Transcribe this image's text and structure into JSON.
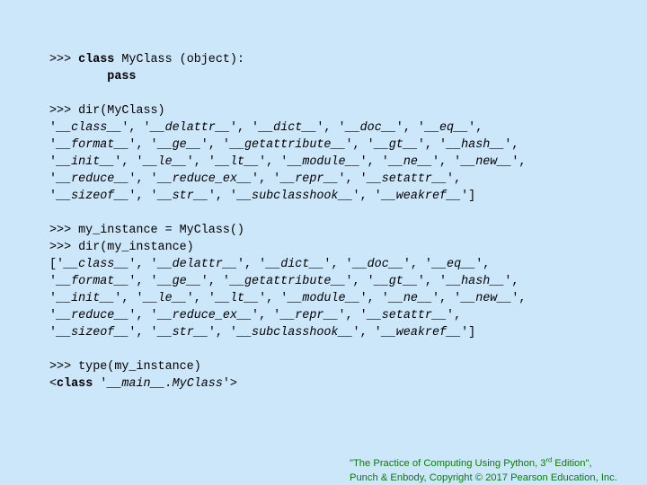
{
  "code_lines": [
    [
      {
        "t": ">>> "
      },
      {
        "t": "class",
        "kw": true
      },
      {
        "t": " MyClass (object):"
      }
    ],
    [
      {
        "t": "        "
      },
      {
        "t": "pass",
        "kw": true
      }
    ],
    [],
    [
      {
        "t": ">>> dir(MyClass)"
      }
    ],
    [
      {
        "t": "'"
      },
      {
        "t": "__class__",
        "it": true
      },
      {
        "t": "', '"
      },
      {
        "t": "__delattr__",
        "it": true
      },
      {
        "t": "', '"
      },
      {
        "t": "__dict__",
        "it": true
      },
      {
        "t": "', '"
      },
      {
        "t": "__doc__",
        "it": true
      },
      {
        "t": "', '"
      },
      {
        "t": "__eq__",
        "it": true
      },
      {
        "t": "',"
      }
    ],
    [
      {
        "t": "'"
      },
      {
        "t": "__format__",
        "it": true
      },
      {
        "t": "', '"
      },
      {
        "t": "__ge__",
        "it": true
      },
      {
        "t": "', '"
      },
      {
        "t": "__getattribute__",
        "it": true
      },
      {
        "t": "', '"
      },
      {
        "t": "__gt__",
        "it": true
      },
      {
        "t": "', '"
      },
      {
        "t": "__hash__",
        "it": true
      },
      {
        "t": "',"
      }
    ],
    [
      {
        "t": "'"
      },
      {
        "t": "__init__",
        "it": true
      },
      {
        "t": "', '"
      },
      {
        "t": "__le__",
        "it": true
      },
      {
        "t": "', '"
      },
      {
        "t": "__lt__",
        "it": true
      },
      {
        "t": "', '"
      },
      {
        "t": "__module__",
        "it": true
      },
      {
        "t": "', '"
      },
      {
        "t": "__ne__",
        "it": true
      },
      {
        "t": "', '"
      },
      {
        "t": "__new__",
        "it": true
      },
      {
        "t": "',"
      }
    ],
    [
      {
        "t": "'"
      },
      {
        "t": "__reduce__",
        "it": true
      },
      {
        "t": "', '"
      },
      {
        "t": "__reduce_ex__",
        "it": true
      },
      {
        "t": "', '"
      },
      {
        "t": "__repr__",
        "it": true
      },
      {
        "t": "', '"
      },
      {
        "t": "__setattr__",
        "it": true
      },
      {
        "t": "',"
      }
    ],
    [
      {
        "t": "'"
      },
      {
        "t": "__sizeof__",
        "it": true
      },
      {
        "t": "', '"
      },
      {
        "t": "__str__",
        "it": true
      },
      {
        "t": "', '"
      },
      {
        "t": "__subclasshook__",
        "it": true
      },
      {
        "t": "', '"
      },
      {
        "t": "__weakref__",
        "it": true
      },
      {
        "t": "']"
      }
    ],
    [],
    [
      {
        "t": ">>> my_instance = MyClass()"
      }
    ],
    [
      {
        "t": ">>> dir(my_instance)"
      }
    ],
    [
      {
        "t": "['"
      },
      {
        "t": "__class__",
        "it": true
      },
      {
        "t": "', '"
      },
      {
        "t": "__delattr__",
        "it": true
      },
      {
        "t": "', '"
      },
      {
        "t": "__dict__",
        "it": true
      },
      {
        "t": "', '"
      },
      {
        "t": "__doc__",
        "it": true
      },
      {
        "t": "', '"
      },
      {
        "t": "__eq__",
        "it": true
      },
      {
        "t": "',"
      }
    ],
    [
      {
        "t": "'"
      },
      {
        "t": "__format__",
        "it": true
      },
      {
        "t": "', '"
      },
      {
        "t": "__ge__",
        "it": true
      },
      {
        "t": "', '"
      },
      {
        "t": "__getattribute__",
        "it": true
      },
      {
        "t": "', '"
      },
      {
        "t": "__gt__",
        "it": true
      },
      {
        "t": "', '"
      },
      {
        "t": "__hash__",
        "it": true
      },
      {
        "t": "',"
      }
    ],
    [
      {
        "t": "'"
      },
      {
        "t": "__init__",
        "it": true
      },
      {
        "t": "', '"
      },
      {
        "t": "__le__",
        "it": true
      },
      {
        "t": "', '"
      },
      {
        "t": "__lt__",
        "it": true
      },
      {
        "t": "', '"
      },
      {
        "t": "__module__",
        "it": true
      },
      {
        "t": "', '"
      },
      {
        "t": "__ne__",
        "it": true
      },
      {
        "t": "', '"
      },
      {
        "t": "__new__",
        "it": true
      },
      {
        "t": "',"
      }
    ],
    [
      {
        "t": "'"
      },
      {
        "t": "__reduce__",
        "it": true
      },
      {
        "t": "', '"
      },
      {
        "t": "__reduce_ex__",
        "it": true
      },
      {
        "t": "', '"
      },
      {
        "t": "__repr__",
        "it": true
      },
      {
        "t": "', '"
      },
      {
        "t": "__setattr__",
        "it": true
      },
      {
        "t": "',"
      }
    ],
    [
      {
        "t": "'"
      },
      {
        "t": "__sizeof__",
        "it": true
      },
      {
        "t": "', '"
      },
      {
        "t": "__str__",
        "it": true
      },
      {
        "t": "', '"
      },
      {
        "t": "__subclasshook__",
        "it": true
      },
      {
        "t": "', '"
      },
      {
        "t": "__weakref__",
        "it": true
      },
      {
        "t": "']"
      }
    ],
    [],
    [
      {
        "t": ">>> type(my_instance)"
      }
    ],
    [
      {
        "t": "<"
      },
      {
        "t": "class",
        "kw": true
      },
      {
        "t": " '"
      },
      {
        "t": "__main__.MyClass",
        "it": true
      },
      {
        "t": "'>"
      }
    ]
  ],
  "footer": {
    "line1_before": "\"The Practice of Computing Using Python, 3",
    "line1_sup": "rd",
    "line1_after": " Edition\",",
    "line2": "Punch & Enbody, Copyright © 2017 Pearson Education, Inc."
  },
  "colors": {
    "background": "#cce6fa",
    "footer_text": "#0d7a0d"
  }
}
